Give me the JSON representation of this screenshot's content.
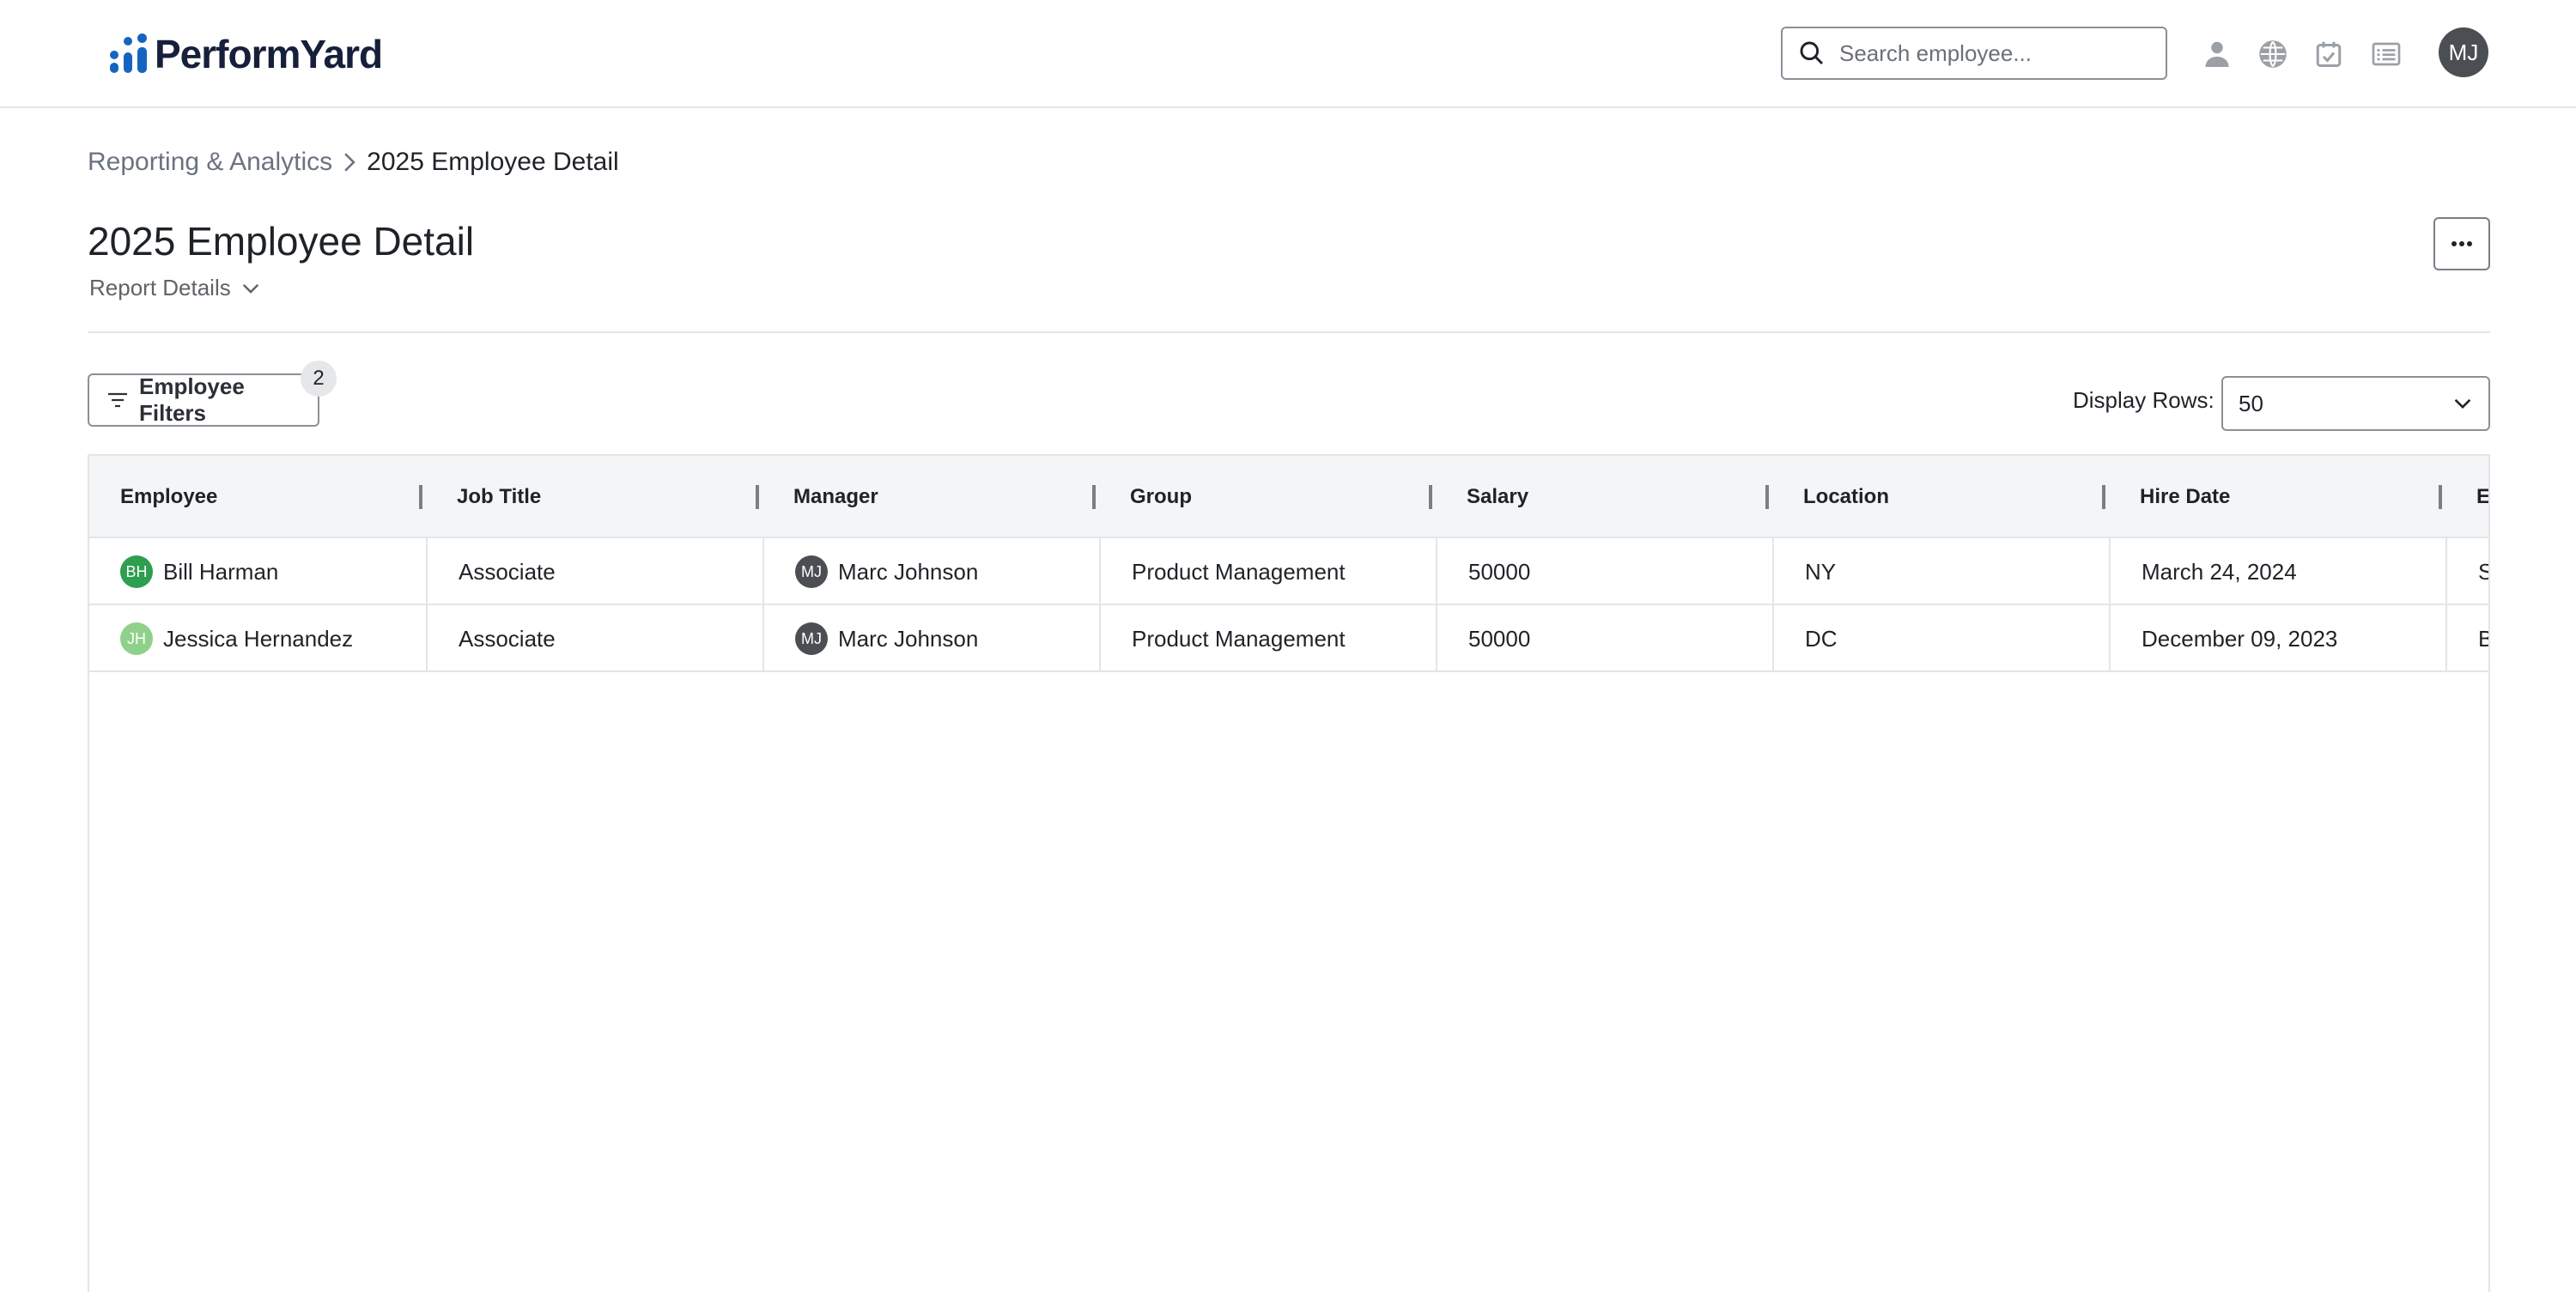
{
  "app": {
    "logo_text": "PerformYard",
    "brand_color": "#1565c0"
  },
  "search": {
    "placeholder": "Search employee...",
    "icon": "search-icon"
  },
  "top_icons": [
    "person-icon",
    "globe-icon",
    "calendar-check-icon",
    "list-icon"
  ],
  "user": {
    "initials": "MJ",
    "avatar_color": "#4b4f54"
  },
  "breadcrumb": {
    "parent": "Reporting & Analytics",
    "current": "2025 Employee Detail"
  },
  "page": {
    "title": "2025 Employee Detail",
    "report_details_label": "Report Details"
  },
  "filters": {
    "button_label": "Employee Filters",
    "count": "2"
  },
  "display_rows": {
    "label": "Display Rows:",
    "value": "50"
  },
  "table": {
    "columns": [
      "Employee",
      "Job Title",
      "Manager",
      "Group",
      "Salary",
      "Location",
      "Hire Date",
      "Ed"
    ],
    "rows": [
      {
        "employee": "Bill Harman",
        "employee_initials": "BH",
        "employee_avatar_color": "#2e9e4f",
        "job_title": "Associate",
        "manager": "Marc Johnson",
        "manager_initials": "MJ",
        "group": "Product Management",
        "salary": "50000",
        "location": "NY",
        "hire_date": "March 24, 2024",
        "extra": "So"
      },
      {
        "employee": "Jessica Hernandez",
        "employee_initials": "JH",
        "employee_avatar_color": "#8fd18a",
        "job_title": "Associate",
        "manager": "Marc Johnson",
        "manager_initials": "MJ",
        "group": "Product Management",
        "salary": "50000",
        "location": "DC",
        "hire_date": "December 09, 2023",
        "extra": "Ba"
      }
    ]
  }
}
